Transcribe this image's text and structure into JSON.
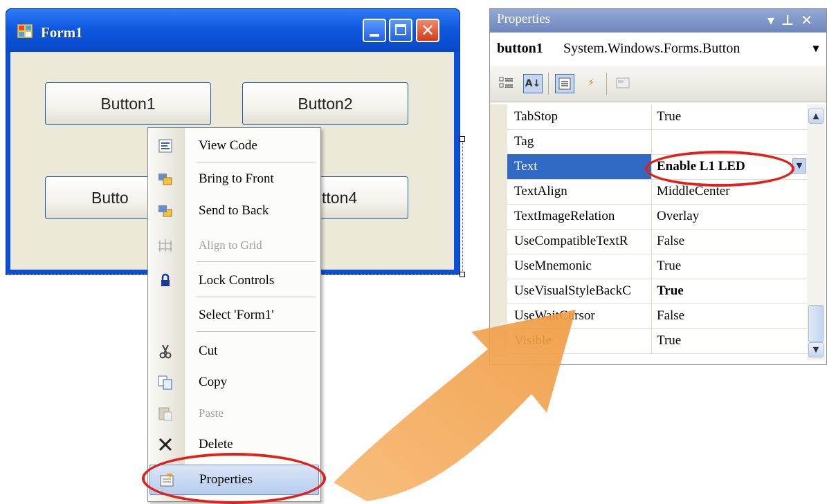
{
  "form": {
    "title": "Form1",
    "buttons": [
      "Button1",
      "Button2",
      "Button3",
      "Button4"
    ],
    "visible_button3": "Butto",
    "visible_button4": "tton4"
  },
  "context_menu": {
    "items": [
      {
        "label": "View Code",
        "icon": "view-code-icon",
        "enabled": true
      },
      {
        "label": "Bring to Front",
        "icon": "bring-to-front-icon",
        "enabled": true
      },
      {
        "label": "Send to Back",
        "icon": "send-to-back-icon",
        "enabled": true
      },
      {
        "label": "Align to Grid",
        "icon": "align-to-grid-icon",
        "enabled": false
      },
      {
        "label": "Lock Controls",
        "icon": "lock-icon",
        "enabled": true
      },
      {
        "label": "Select 'Form1'",
        "icon": "",
        "enabled": true
      },
      {
        "label": "Cut",
        "icon": "scissors-icon",
        "enabled": true
      },
      {
        "label": "Copy",
        "icon": "copy-icon",
        "enabled": true
      },
      {
        "label": "Paste",
        "icon": "paste-icon",
        "enabled": false
      },
      {
        "label": "Delete",
        "icon": "delete-icon",
        "enabled": true
      },
      {
        "label": "Properties",
        "icon": "properties-icon",
        "enabled": true,
        "highlighted": true
      }
    ]
  },
  "properties_panel": {
    "title": "Properties",
    "header_buttons": [
      "▾",
      "⊥",
      "✕"
    ],
    "object_name": "button1",
    "object_type": "System.Windows.Forms.Button",
    "toolbar": [
      "categorized-icon",
      "alphabetical-icon",
      "properties-icon",
      "events-icon",
      "property-pages-icon"
    ],
    "toolbar_glyphs": {
      "alphabetical": "A↓",
      "events": "⚡"
    },
    "rows": [
      {
        "name": "TabStop",
        "value": "True"
      },
      {
        "name": "Tag",
        "value": ""
      },
      {
        "name": "Text",
        "value": "Enable L1 LED",
        "selected": true
      },
      {
        "name": "TextAlign",
        "value": "MiddleCenter"
      },
      {
        "name": "TextImageRelation",
        "value": "Overlay"
      },
      {
        "name": "UseCompatibleTextR",
        "value": "False"
      },
      {
        "name": "UseMnemonic",
        "value": "True"
      },
      {
        "name": "UseVisualStyleBackC",
        "value": "True",
        "bold": true
      },
      {
        "name": "UseWaitCursor",
        "value": "False"
      },
      {
        "name": "Visible",
        "value": "True"
      }
    ]
  },
  "colors": {
    "highlight_ring": "#e0201a",
    "arrow": "#f2a04a",
    "selection": "#316ac5",
    "title_bar": "#0e58e0"
  }
}
